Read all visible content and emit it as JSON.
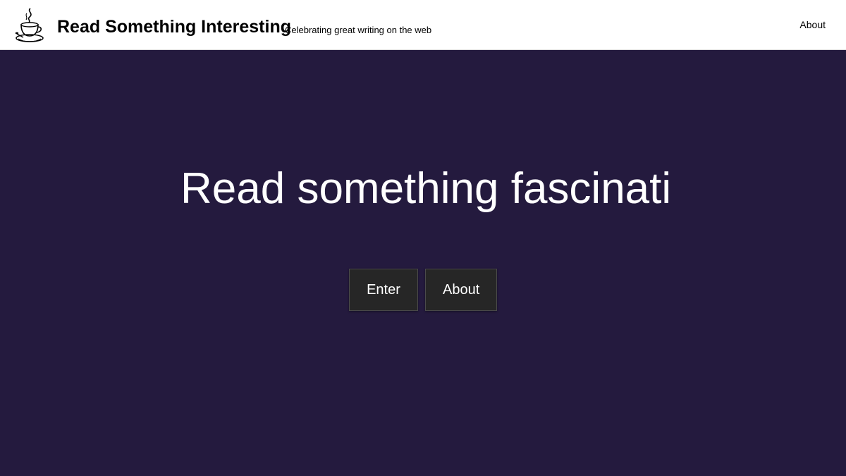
{
  "header": {
    "site_title": "Read Something Interesting",
    "tagline": "Celebrating great writing on the web",
    "nav_about": "About",
    "logo_icon": "coffee-cup-icon"
  },
  "hero": {
    "heading": "Read something fascinatil",
    "enter_label": "Enter",
    "about_label": "About",
    "background_color": "#241a3e",
    "button_color": "#262626"
  }
}
